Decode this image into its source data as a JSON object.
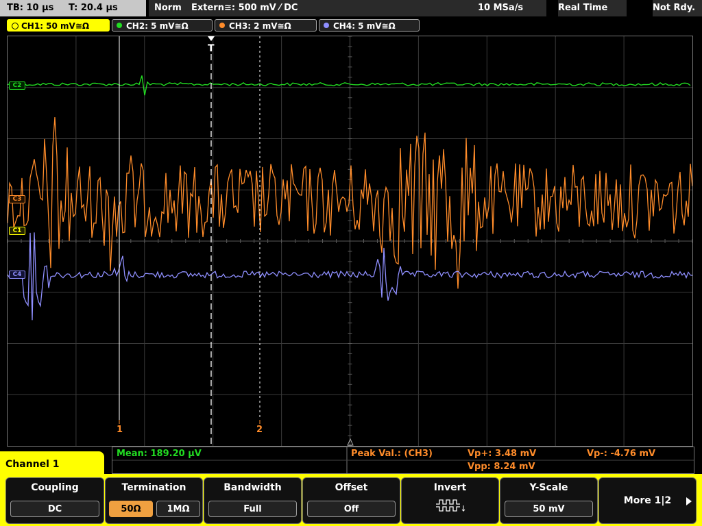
{
  "status_bar": {
    "timebase": "TB: 10 µs",
    "trigger_time": "T: 20.4 µs",
    "trigger_mode": "Norm",
    "trigger_source": "Extern≅: 500 mV ⁄ DC",
    "sample_rate": "10 MSa/s",
    "acq_mode": "Real Time",
    "acq_state": "Not Rdy."
  },
  "channels": [
    {
      "label": "CH1: 50 mV≅Ω",
      "color": "#ffff00"
    },
    {
      "label": "CH2: 5 mV≅Ω",
      "color": "#22dd22"
    },
    {
      "label": "CH3: 2 mV≅Ω",
      "color": "#ff8c2a"
    },
    {
      "label": "CH4: 5 mV≅Ω",
      "color": "#8f8fff"
    }
  ],
  "markers": {
    "c2": "C2",
    "c3": "C3",
    "c1": "C1",
    "c4": "C4",
    "trigger": "T",
    "cursor1": "1",
    "cursor2": "2"
  },
  "measurements": {
    "mean": "Mean: 189.20 µV",
    "peak_label": "Peak Val.:  (CH3)",
    "vp_plus": "Vp+: 3.48 mV",
    "vp_minus": "Vp-: -4.76 mV",
    "vpp": "Vpp: 8.24 mV"
  },
  "menu_title": "Channel 1",
  "softkeys": {
    "coupling": {
      "label": "Coupling",
      "value": "DC"
    },
    "termination": {
      "label": "Termination",
      "opt1": "50Ω",
      "opt2": "1MΩ"
    },
    "bandwidth": {
      "label": "Bandwidth",
      "value": "Full"
    },
    "offset": {
      "label": "Offset",
      "value": "Off"
    },
    "invert": {
      "label": "Invert"
    },
    "yscale": {
      "label": "Y-Scale",
      "value": "50 mV"
    },
    "more": {
      "label": "More 1|2"
    }
  }
}
